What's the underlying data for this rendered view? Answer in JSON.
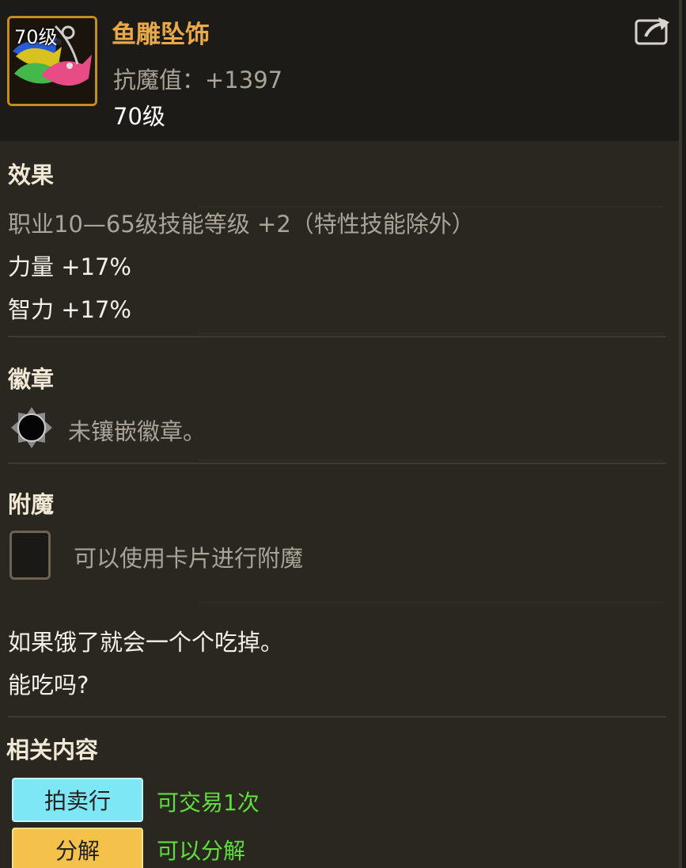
{
  "item": {
    "icon_level": "70级",
    "name": "鱼雕坠饰",
    "stat": "抗魔值：+1397",
    "level": "70级"
  },
  "sections": {
    "effect": {
      "title": "效果",
      "lines": [
        "职业10—65级技能等级 +2（特性技能除外）",
        "力量 +17%",
        "智力 +17%"
      ]
    },
    "badge": {
      "title": "徽章",
      "text": "未镶嵌徽章。"
    },
    "enchant": {
      "title": "附魔",
      "text": "可以使用卡片进行附魔"
    },
    "flavor": {
      "lines": [
        "如果饿了就会一个个吃掉。",
        "能吃吗?"
      ]
    },
    "related": {
      "title": "相关内容",
      "auction_button": "拍卖行",
      "auction_note": "可交易1次",
      "dismantle_button": "分解",
      "dismantle_note": "可以分解"
    }
  },
  "colors": {
    "title": "#e9a948",
    "accent_green": "#5fde3e",
    "auction_button": "#7ee7f6",
    "dismantle_button": "#f4c24a"
  },
  "icons": {
    "share": "share-icon",
    "badge": "badge-socket-icon"
  }
}
